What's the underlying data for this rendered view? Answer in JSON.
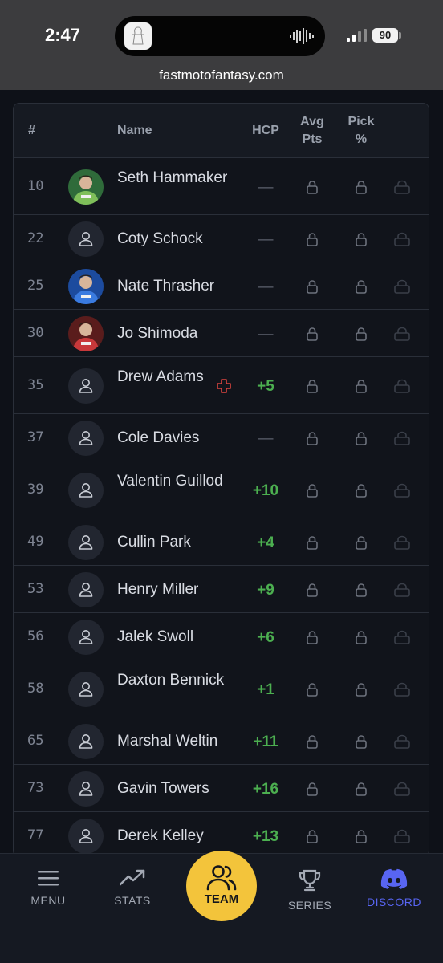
{
  "status_bar": {
    "time": "2:47",
    "battery": "90",
    "url": "fastmotofantasy.com"
  },
  "table": {
    "headers": {
      "rank": "#",
      "name": "Name",
      "hcp": "HCP",
      "avg_pts": "Avg\nPts",
      "pick_pct": "Pick\n%"
    },
    "rows": [
      {
        "rank": "10",
        "name": "Seth Hammaker",
        "hcp": "—",
        "avatar": "photo-green",
        "injury": false
      },
      {
        "rank": "22",
        "name": "Coty Schock",
        "hcp": "—",
        "avatar": "placeholder",
        "injury": false
      },
      {
        "rank": "25",
        "name": "Nate Thrasher",
        "hcp": "—",
        "avatar": "photo-blue",
        "injury": false
      },
      {
        "rank": "30",
        "name": "Jo Shimoda",
        "hcp": "—",
        "avatar": "photo-red",
        "injury": false
      },
      {
        "rank": "35",
        "name": "Drew Adams",
        "hcp": "+5",
        "avatar": "placeholder",
        "injury": true
      },
      {
        "rank": "37",
        "name": "Cole Davies",
        "hcp": "—",
        "avatar": "placeholder",
        "injury": false
      },
      {
        "rank": "39",
        "name": "Valentin Guillod",
        "hcp": "+10",
        "avatar": "placeholder",
        "injury": false
      },
      {
        "rank": "49",
        "name": "Cullin Park",
        "hcp": "+4",
        "avatar": "placeholder",
        "injury": false
      },
      {
        "rank": "53",
        "name": "Henry Miller",
        "hcp": "+9",
        "avatar": "placeholder",
        "injury": false
      },
      {
        "rank": "56",
        "name": "Jalek Swoll",
        "hcp": "+6",
        "avatar": "placeholder",
        "injury": false
      },
      {
        "rank": "58",
        "name": "Daxton Bennick",
        "hcp": "+1",
        "avatar": "placeholder",
        "injury": false
      },
      {
        "rank": "65",
        "name": "Marshal Weltin",
        "hcp": "+11",
        "avatar": "placeholder",
        "injury": false
      },
      {
        "rank": "73",
        "name": "Gavin Towers",
        "hcp": "+16",
        "avatar": "placeholder",
        "injury": false
      },
      {
        "rank": "77",
        "name": "Derek Kelley",
        "hcp": "+13",
        "avatar": "placeholder",
        "injury": false
      }
    ]
  },
  "nav": {
    "menu": "MENU",
    "stats": "STATS",
    "team": "TEAM",
    "series": "SERIES",
    "discord": "DISCORD"
  },
  "colors": {
    "accent": "#f3c43b",
    "positive": "#4caf50",
    "discord": "#5865f2",
    "injury": "#d9443f"
  }
}
